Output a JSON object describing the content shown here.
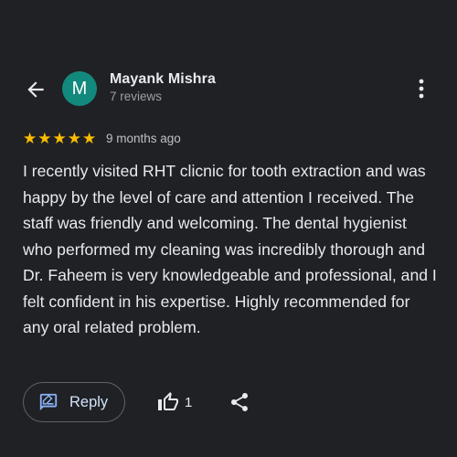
{
  "header": {
    "back_icon": "arrow-back-icon",
    "more_icon": "more-vert-icon"
  },
  "reviewer": {
    "avatar_letter": "M",
    "avatar_color": "#12897d",
    "name": "Mayank Mishra",
    "reviews_count": "7 reviews"
  },
  "rating": {
    "stars": 5,
    "max_stars": 5,
    "star_color": "#fbbc04",
    "time_ago": "9 months ago"
  },
  "review": {
    "text": "I recently visited RHT clicnic for tooth extraction and was happy by the level of care and attention I received. The staff was friendly and welcoming. The dental hygienist who performed my cleaning was incredibly thorough and Dr. Faheem is very knowledgeable and professional, and I felt confident in his expertise. Highly recommended for any oral related problem."
  },
  "actions": {
    "reply_label": "Reply",
    "reply_icon": "rate-review-icon",
    "like_icon": "thumb-up-icon",
    "like_count": "1",
    "share_icon": "share-icon"
  },
  "colors": {
    "background": "#202124",
    "primary_text": "#e8eaed",
    "secondary_text": "#9aa0a6",
    "accent": "#8ab4f8"
  }
}
